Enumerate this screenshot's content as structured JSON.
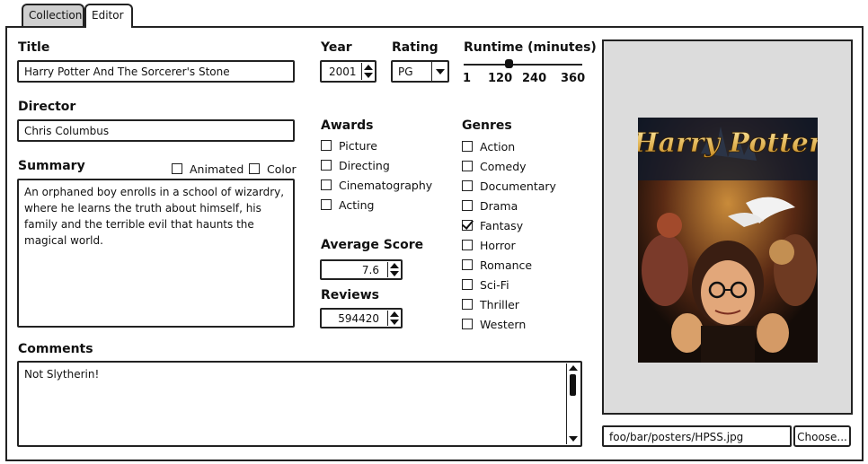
{
  "tabs": [
    {
      "label": "Collection",
      "active": false
    },
    {
      "label": "Editor",
      "active": true
    }
  ],
  "title": {
    "label": "Title",
    "value": "Harry Potter And The Sorcerer's Stone"
  },
  "director": {
    "label": "Director",
    "value": "Chris Columbus"
  },
  "summary": {
    "label": "Summary",
    "text": "An orphaned boy enrolls in a school of wizardry, where he learns the truth about himself, his family and the terrible evil that haunts the magical world.",
    "animated": {
      "label": "Animated",
      "checked": false
    },
    "color": {
      "label": "Color",
      "checked": false
    }
  },
  "comments": {
    "label": "Comments",
    "value": "Not Slytherin!"
  },
  "year": {
    "label": "Year",
    "value": "2001"
  },
  "rating": {
    "label": "Rating",
    "value": "PG"
  },
  "runtime": {
    "label": "Runtime (minutes)",
    "ticks": [
      "1",
      "120",
      "240",
      "360"
    ],
    "value_fraction": 0.38
  },
  "awards": {
    "label": "Awards",
    "items": [
      {
        "label": "Picture",
        "checked": false
      },
      {
        "label": "Directing",
        "checked": false
      },
      {
        "label": "Cinematography",
        "checked": false
      },
      {
        "label": "Acting",
        "checked": false
      }
    ]
  },
  "average_score": {
    "label": "Average Score",
    "value": "7.6"
  },
  "reviews": {
    "label": "Reviews",
    "value": "594420"
  },
  "genres": {
    "label": "Genres",
    "items": [
      {
        "label": "Action",
        "checked": false
      },
      {
        "label": "Comedy",
        "checked": false
      },
      {
        "label": "Documentary",
        "checked": false
      },
      {
        "label": "Drama",
        "checked": false
      },
      {
        "label": "Fantasy",
        "checked": true
      },
      {
        "label": "Horror",
        "checked": false
      },
      {
        "label": "Romance",
        "checked": false
      },
      {
        "label": "Sci-Fi",
        "checked": false
      },
      {
        "label": "Thriller",
        "checked": false
      },
      {
        "label": "Western",
        "checked": false
      }
    ]
  },
  "poster": {
    "title_line1": "Harry Potter",
    "path": "foo/bar/posters/HPSS.jpg",
    "choose_label": "Choose..."
  },
  "colors": {
    "panel_gray": "#dcdcdc",
    "tab_gray": "#cfcfcf",
    "border": "#222222"
  }
}
